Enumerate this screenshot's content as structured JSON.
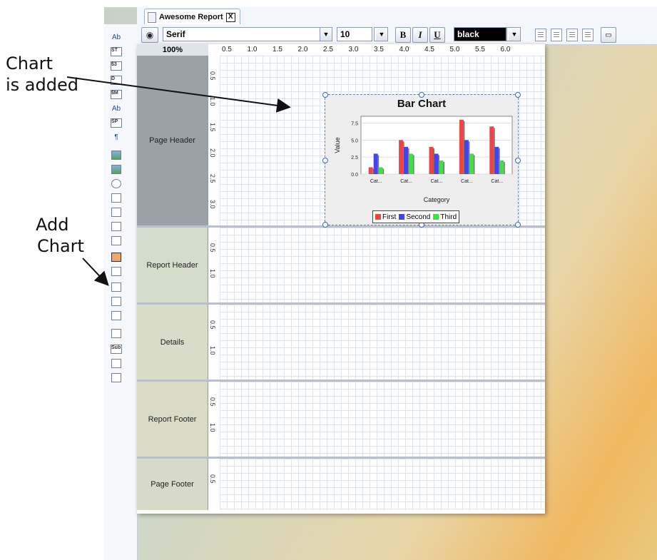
{
  "annotations": {
    "chart_added_line1": "Chart",
    "chart_added_line2": "is added",
    "add_chart_line1": "Add",
    "add_chart_line2": "Chart"
  },
  "tab": {
    "title": "Awesome Report",
    "close": "X"
  },
  "palette": {
    "items": [
      {
        "icon": "text-label-icon",
        "text": "Ab"
      },
      {
        "icon": "static-text-icon",
        "text": "ST"
      },
      {
        "icon": "number-field-icon",
        "text": "$3"
      },
      {
        "icon": "date-field-icon",
        "text": "D"
      },
      {
        "icon": "message-field-icon",
        "text": "$M"
      },
      {
        "icon": "resource-label-icon",
        "text": "Ab"
      },
      {
        "icon": "resource-field-icon",
        "text": "SP"
      },
      {
        "icon": "resource-message-icon",
        "text": "¶"
      },
      {
        "icon": "image-icon",
        "text": ""
      },
      {
        "icon": "image-field-icon",
        "text": ""
      },
      {
        "icon": "ellipse-icon",
        "text": ""
      },
      {
        "icon": "rectangle-icon",
        "text": ""
      },
      {
        "icon": "horizontal-line-icon",
        "text": ""
      },
      {
        "icon": "vertical-line-icon",
        "text": ""
      },
      {
        "icon": "survey-scale-icon",
        "text": ""
      },
      {
        "icon": "chart-icon",
        "text": ""
      },
      {
        "icon": "barcode-icon",
        "text": ""
      },
      {
        "icon": "subreport-icon",
        "text": ""
      },
      {
        "icon": "subreport-2-icon",
        "text": ""
      },
      {
        "icon": "subreport-3-icon",
        "text": ""
      },
      {
        "icon": "band-icon",
        "text": ""
      },
      {
        "icon": "sub-band-icon",
        "text": "Sub"
      },
      {
        "icon": "content-icon",
        "text": ""
      },
      {
        "icon": "content-2-icon",
        "text": ""
      }
    ]
  },
  "toolbar": {
    "font_family": "Serif",
    "font_size": "10",
    "bold": "B",
    "italic": "I",
    "underline": "U",
    "color": "black"
  },
  "zoom": "100%",
  "hruler_ticks": [
    "0.5",
    "1.0",
    "1.5",
    "2.0",
    "2.5",
    "3.0",
    "3.5",
    "4.0",
    "4.5",
    "5.0",
    "5.5",
    "6.0"
  ],
  "bands": [
    {
      "label": "Page Header",
      "ticks": [
        "0.5",
        "1.0",
        "1.5",
        "2.0",
        "2.5",
        "3.0"
      ]
    },
    {
      "label": "Report Header",
      "ticks": [
        "0.5",
        "1.0"
      ]
    },
    {
      "label": "Details",
      "ticks": [
        "0.5",
        "1.0"
      ]
    },
    {
      "label": "Report Footer",
      "ticks": [
        "0.5",
        "1.0"
      ]
    },
    {
      "label": "Page Footer",
      "ticks": [
        "0.5"
      ]
    }
  ],
  "chart_data": {
    "type": "bar",
    "title": "Bar Chart",
    "xlabel": "Category",
    "ylabel": "Value",
    "categories": [
      "Cat...",
      "Cat...",
      "Cat...",
      "Cat...",
      "Cat..."
    ],
    "ylim": [
      0,
      8.5
    ],
    "yticks": [
      "0.0",
      "2.5",
      "5.0",
      "7.5"
    ],
    "legend_position": "bottom",
    "series": [
      {
        "name": "First",
        "color": "#ee4444",
        "values": [
          1,
          5,
          4,
          8,
          7
        ]
      },
      {
        "name": "Second",
        "color": "#4444ee",
        "values": [
          3,
          4,
          3,
          5,
          4
        ]
      },
      {
        "name": "Third",
        "color": "#44dd44",
        "values": [
          1,
          3,
          2,
          3,
          2
        ]
      }
    ]
  }
}
